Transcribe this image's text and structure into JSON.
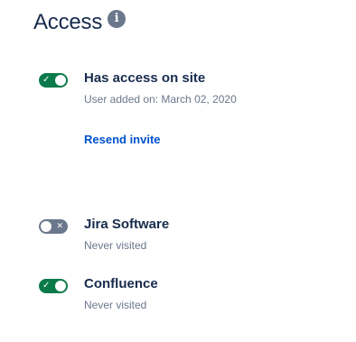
{
  "access": {
    "title": "Access",
    "info_icon": "info-icon"
  },
  "site_access": {
    "label": "Has access on site",
    "enabled": true,
    "added_text": "User added on: March 02, 2020",
    "resend_label": "Resend invite"
  },
  "products": [
    {
      "label": "Jira Software",
      "enabled": false,
      "status": "Never visited"
    },
    {
      "label": "Confluence",
      "enabled": true,
      "status": "Never visited"
    }
  ],
  "colors": {
    "toggle_on": "#0b7a4b",
    "toggle_off": "#6b778c",
    "link": "#0052cc",
    "heading": "#172b4d",
    "subtext": "#6b778c"
  }
}
